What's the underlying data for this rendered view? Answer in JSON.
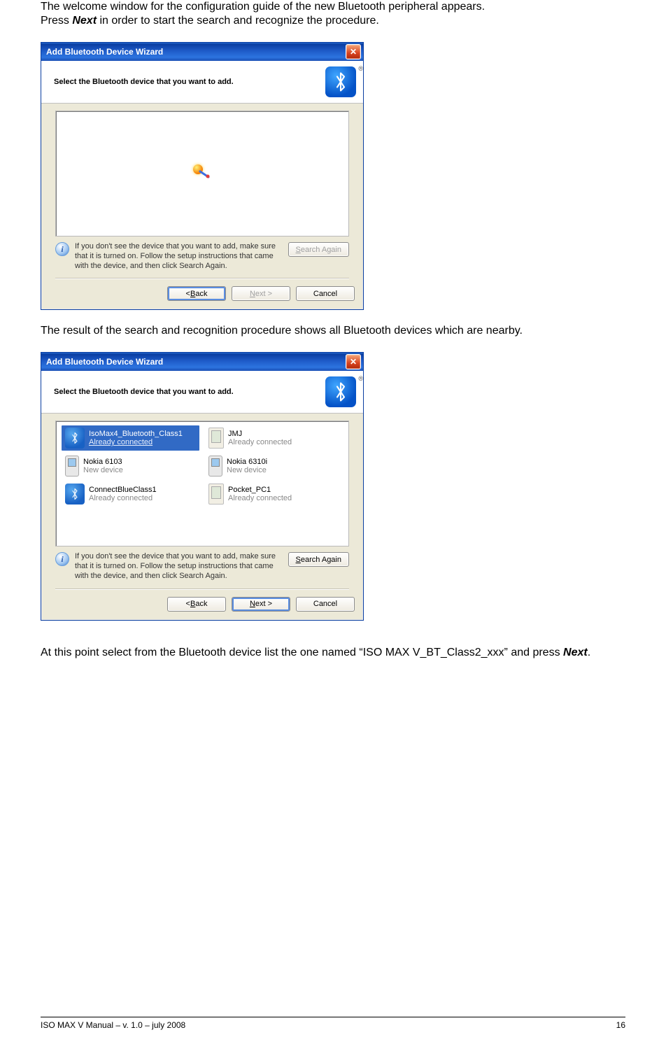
{
  "para1_a": "The welcome window for the configuration guide of the new Bluetooth peripheral appears.",
  "para1_b_prefix": "Press ",
  "para1_b_bold": "Next",
  "para1_b_suffix": " in order to start the search and recognize the procedure.",
  "para2": "The result of the search and recognition procedure shows all Bluetooth devices which are nearby.",
  "para3_prefix": "At this point select from the Bluetooth device list the one named “ISO MAX V_BT_Class2_xxx” and press ",
  "para3_bold": "Next",
  "para3_suffix": ".",
  "footer_left": "ISO MAX V Manual – v. 1.0 – july 2008",
  "footer_right": "16",
  "wizard": {
    "title": "Add Bluetooth Device Wizard",
    "header": "Select the Bluetooth device that you want to add.",
    "info": "If you don't see the device that you want to add, make sure that it is turned on. Follow the setup instructions that came with the device, and then click Search Again.",
    "btn_search_u": "S",
    "btn_search_rest": "earch Again",
    "btn_back_prefix": "< ",
    "btn_back_u": "B",
    "btn_back_rest": "ack",
    "btn_next_u": "N",
    "btn_next_rest": "ext >",
    "btn_cancel": "Cancel"
  },
  "devices": {
    "d1_name": "IsoMax4_Bluetooth_Class1",
    "d1_sub": "Already connected",
    "d2_name": "JMJ",
    "d2_sub": "Already connected",
    "d3_name": "Nokia 6103",
    "d3_sub": "New device",
    "d4_name": "Nokia 6310i",
    "d4_sub": "New device",
    "d5_name": "ConnectBlueClass1",
    "d5_sub": "Already connected",
    "d6_name": "Pocket_PC1",
    "d6_sub": "Already connected"
  }
}
